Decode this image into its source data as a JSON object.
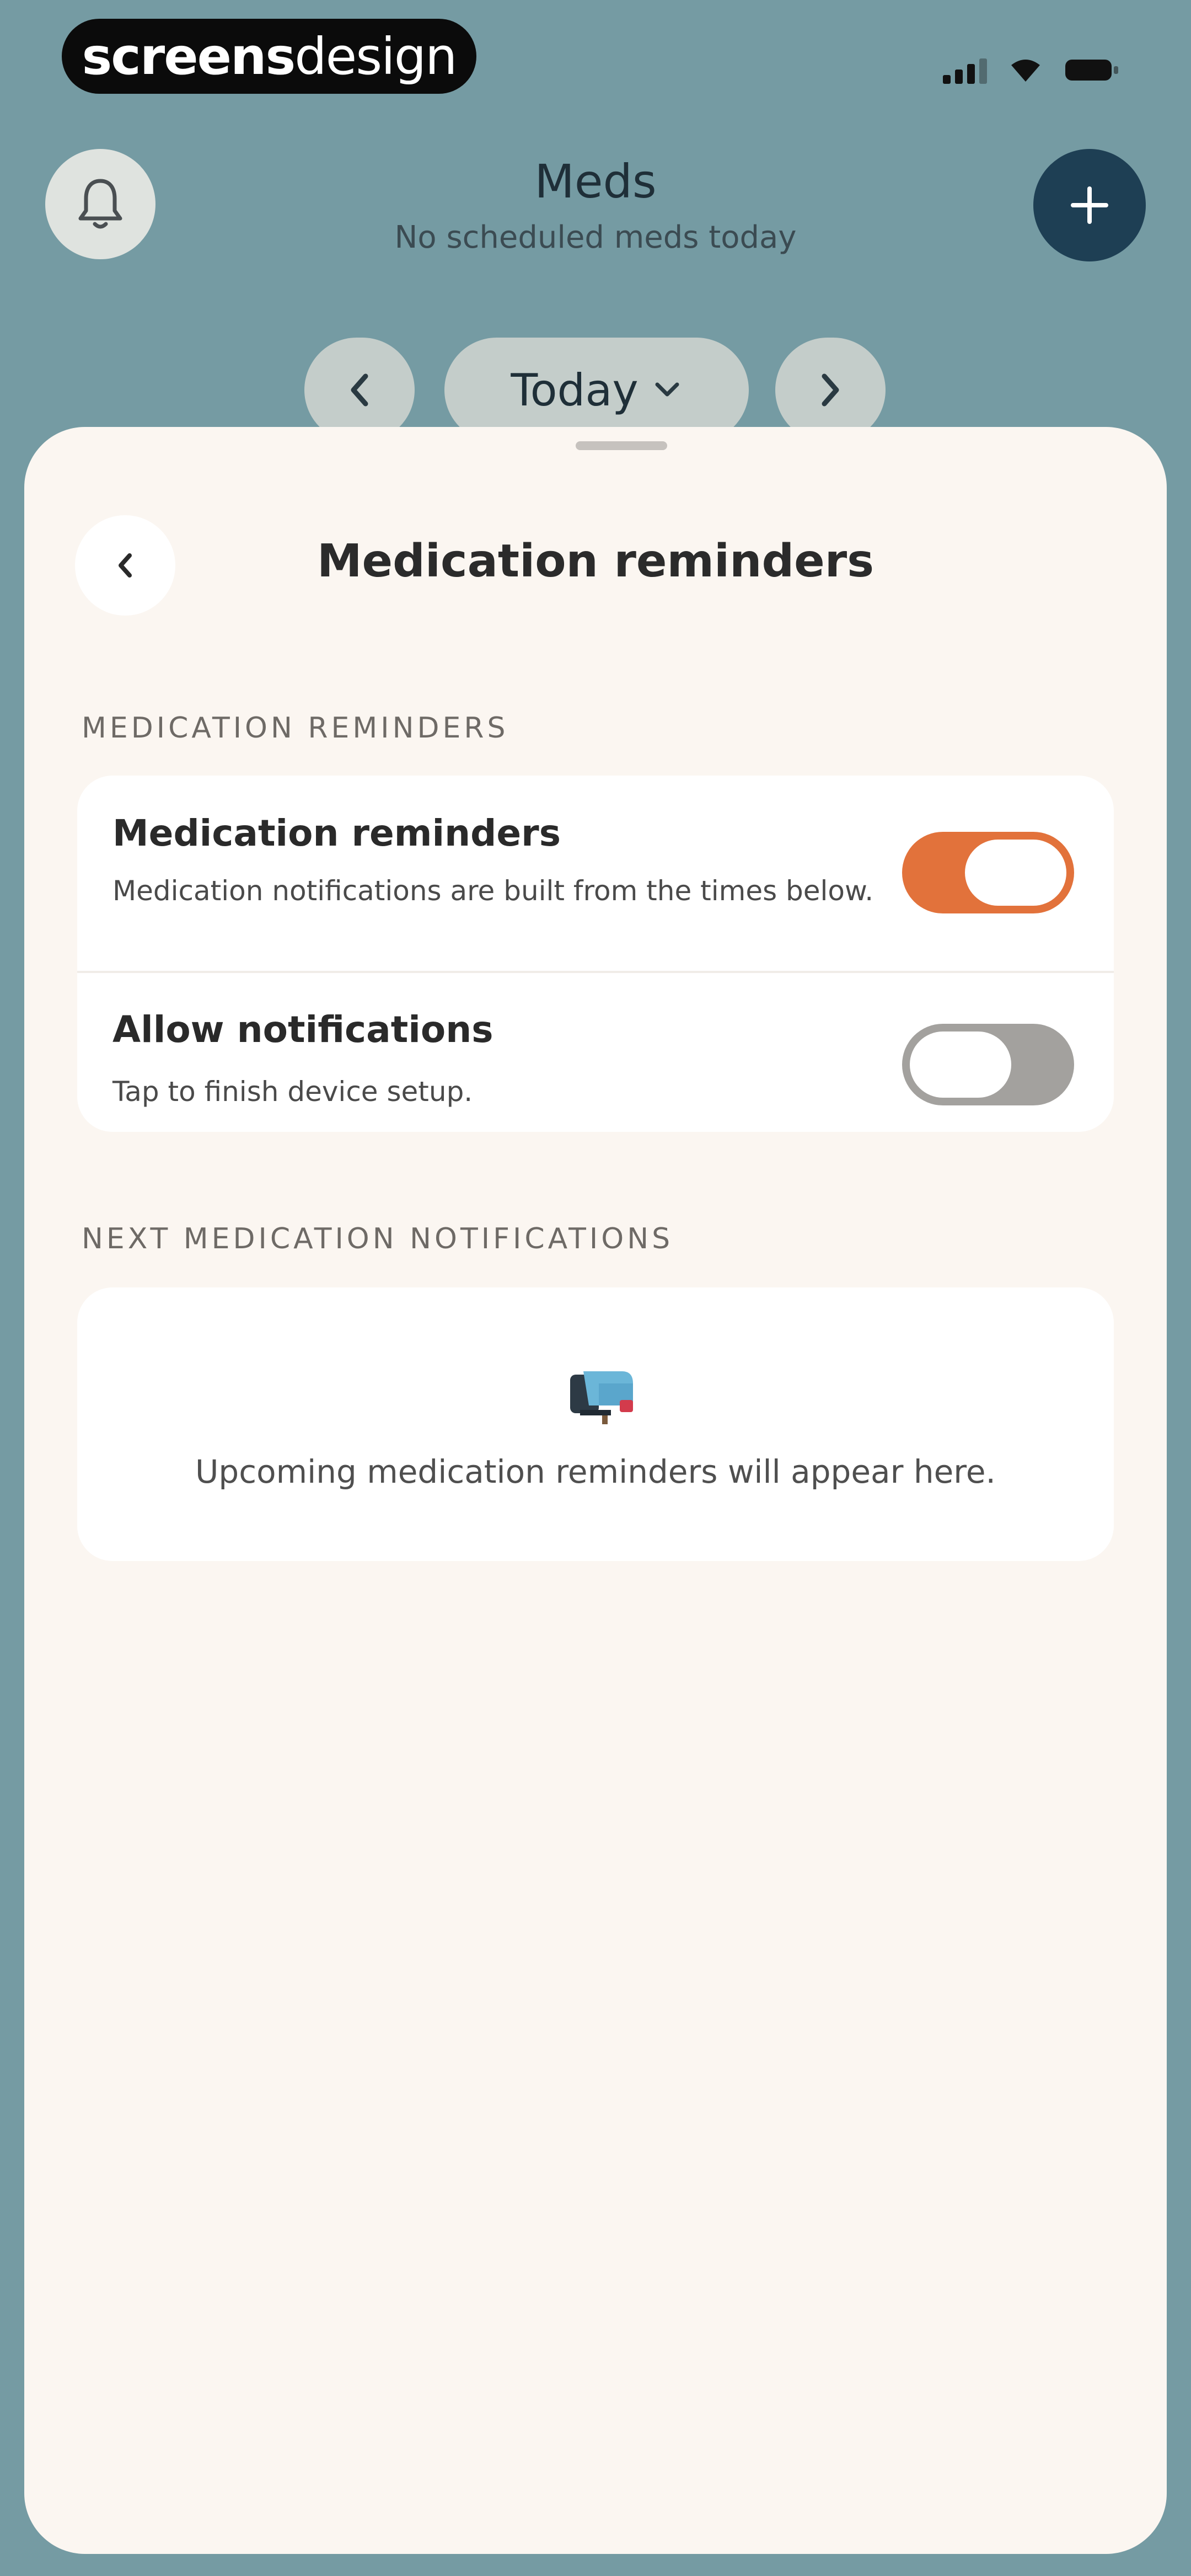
{
  "status_bar": {
    "brand_bold": "screens",
    "brand_light": "design",
    "signal_icon": "cellular-signal-icon",
    "wifi_icon": "wifi-icon",
    "battery_icon": "battery-icon"
  },
  "header": {
    "title": "Meds",
    "subtitle": "No scheduled meds today",
    "bell_icon": "bell-icon",
    "add_icon": "plus-icon"
  },
  "date_nav": {
    "prev_icon": "chevron-left-icon",
    "current": "Today",
    "dropdown_icon": "chevron-down-icon",
    "next_icon": "chevron-right-icon"
  },
  "sheet": {
    "title": "Medication reminders",
    "back_icon": "chevron-left-icon",
    "section_reminders": "MEDICATION REMINDERS",
    "rows": [
      {
        "title": "Medication reminders",
        "description": "Medication notifications are built from the times below.",
        "enabled": true
      },
      {
        "title": "Allow notifications",
        "description": "Tap to finish device setup.",
        "enabled": false
      }
    ],
    "section_next": "NEXT MEDICATION NOTIFICATIONS",
    "empty_icon": "mailbox-icon",
    "empty_text": "Upcoming medication reminders will appear here."
  },
  "colors": {
    "background": "#759ba3",
    "sheet": "#fbf6f1",
    "accent_orange": "#e2723b",
    "add_button": "#1e3f54"
  }
}
